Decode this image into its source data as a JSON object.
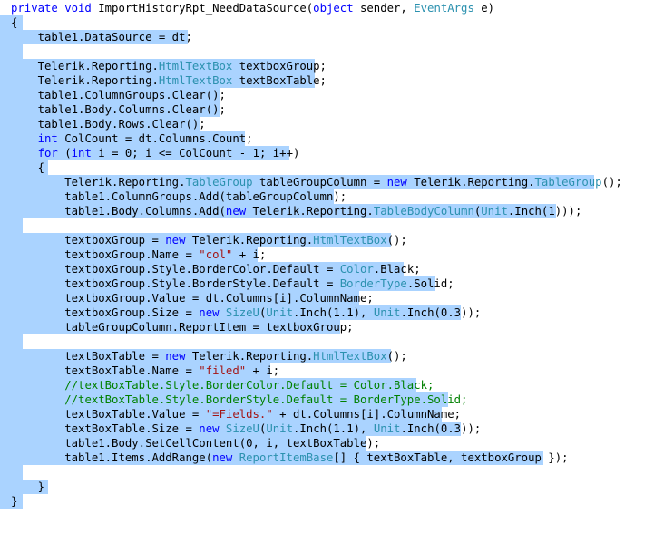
{
  "editor": {
    "colors": {
      "keyword": "#0000ff",
      "type": "#2b91af",
      "string": "#a31515",
      "comment": "#008000",
      "selection": "#aad3ff",
      "text": "#000000"
    },
    "lines": [
      {
        "sel": false,
        "t": [
          [
            "kw",
            "private void "
          ],
          [
            "",
            "ImportHistoryRpt_NeedDataSource("
          ],
          [
            "kw",
            "object"
          ],
          [
            "",
            " sender, "
          ],
          [
            "typ",
            "EventArgs"
          ],
          [
            "",
            " e)"
          ]
        ]
      },
      {
        "sel": true,
        "t": [
          [
            "",
            "{"
          ]
        ]
      },
      {
        "sel": true,
        "t": [
          [
            "",
            "    table1.DataSource = dt;"
          ]
        ]
      },
      {
        "sel": true,
        "t": [
          [
            "",
            ""
          ]
        ]
      },
      {
        "sel": true,
        "t": [
          [
            "",
            "    Telerik.Reporting."
          ],
          [
            "typ",
            "HtmlTextBox"
          ],
          [
            "",
            " textboxGroup;"
          ]
        ]
      },
      {
        "sel": true,
        "t": [
          [
            "",
            "    Telerik.Reporting."
          ],
          [
            "typ",
            "HtmlTextBox"
          ],
          [
            "",
            " textBoxTable;"
          ]
        ]
      },
      {
        "sel": true,
        "t": [
          [
            "",
            "    table1.ColumnGroups.Clear();"
          ]
        ]
      },
      {
        "sel": true,
        "t": [
          [
            "",
            "    table1.Body.Columns.Clear();"
          ]
        ]
      },
      {
        "sel": true,
        "t": [
          [
            "",
            "    table1.Body.Rows.Clear();"
          ]
        ]
      },
      {
        "sel": true,
        "t": [
          [
            "",
            "    "
          ],
          [
            "kw",
            "int"
          ],
          [
            "",
            " ColCount = dt.Columns.Count;"
          ]
        ]
      },
      {
        "sel": true,
        "t": [
          [
            "",
            "    "
          ],
          [
            "kw",
            "for"
          ],
          [
            "",
            " ("
          ],
          [
            "kw",
            "int"
          ],
          [
            "",
            " i = 0; i <= ColCount - 1; i++)"
          ]
        ]
      },
      {
        "sel": true,
        "t": [
          [
            "",
            "    {"
          ]
        ]
      },
      {
        "sel": true,
        "t": [
          [
            "",
            "        Telerik.Reporting."
          ],
          [
            "typ",
            "TableGroup"
          ],
          [
            "",
            " tableGroupColumn = "
          ],
          [
            "kw",
            "new"
          ],
          [
            "",
            " Telerik.Reporting."
          ],
          [
            "typ",
            "TableGroup"
          ],
          [
            "",
            "();"
          ]
        ]
      },
      {
        "sel": true,
        "t": [
          [
            "",
            "        table1.ColumnGroups.Add(tableGroupColumn);"
          ]
        ]
      },
      {
        "sel": true,
        "t": [
          [
            "",
            "        table1.Body.Columns.Add("
          ],
          [
            "kw",
            "new"
          ],
          [
            "",
            " Telerik.Reporting."
          ],
          [
            "typ",
            "TableBodyColumn"
          ],
          [
            "",
            "("
          ],
          [
            "typ",
            "Unit"
          ],
          [
            "",
            ".Inch(1)));"
          ]
        ]
      },
      {
        "sel": true,
        "t": [
          [
            "",
            ""
          ]
        ]
      },
      {
        "sel": true,
        "t": [
          [
            "",
            "        textboxGroup = "
          ],
          [
            "kw",
            "new"
          ],
          [
            "",
            " Telerik.Reporting."
          ],
          [
            "typ",
            "HtmlTextBox"
          ],
          [
            "",
            "();"
          ]
        ]
      },
      {
        "sel": true,
        "t": [
          [
            "",
            "        textboxGroup.Name = "
          ],
          [
            "str",
            "\"col\""
          ],
          [
            "",
            " + i;"
          ]
        ]
      },
      {
        "sel": true,
        "t": [
          [
            "",
            "        textboxGroup.Style.BorderColor.Default = "
          ],
          [
            "typ",
            "Color"
          ],
          [
            "",
            ".Black;"
          ]
        ]
      },
      {
        "sel": true,
        "t": [
          [
            "",
            "        textboxGroup.Style.BorderStyle.Default = "
          ],
          [
            "typ",
            "BorderType"
          ],
          [
            "",
            ".Solid;"
          ]
        ]
      },
      {
        "sel": true,
        "t": [
          [
            "",
            "        textboxGroup.Value = dt.Columns[i].ColumnName;"
          ]
        ]
      },
      {
        "sel": true,
        "t": [
          [
            "",
            "        textboxGroup.Size = "
          ],
          [
            "kw",
            "new"
          ],
          [
            "",
            " "
          ],
          [
            "typ",
            "SizeU"
          ],
          [
            "",
            "("
          ],
          [
            "typ",
            "Unit"
          ],
          [
            "",
            ".Inch(1.1), "
          ],
          [
            "typ",
            "Unit"
          ],
          [
            "",
            ".Inch(0.3));"
          ]
        ]
      },
      {
        "sel": true,
        "t": [
          [
            "",
            "        tableGroupColumn.ReportItem = textboxGroup;"
          ]
        ]
      },
      {
        "sel": true,
        "t": [
          [
            "",
            ""
          ]
        ]
      },
      {
        "sel": true,
        "t": [
          [
            "",
            "        textBoxTable = "
          ],
          [
            "kw",
            "new"
          ],
          [
            "",
            " Telerik.Reporting."
          ],
          [
            "typ",
            "HtmlTextBox"
          ],
          [
            "",
            "();"
          ]
        ]
      },
      {
        "sel": true,
        "t": [
          [
            "",
            "        textBoxTable.Name = "
          ],
          [
            "str",
            "\"filed\""
          ],
          [
            "",
            " + i;"
          ]
        ]
      },
      {
        "sel": true,
        "t": [
          [
            "",
            "        "
          ],
          [
            "cmt",
            "//textBoxTable.Style.BorderColor.Default = Color.Black;"
          ]
        ]
      },
      {
        "sel": true,
        "t": [
          [
            "",
            "        "
          ],
          [
            "cmt",
            "//textBoxTable.Style.BorderStyle.Default = BorderType.Solid;"
          ]
        ]
      },
      {
        "sel": true,
        "t": [
          [
            "",
            "        textBoxTable.Value = "
          ],
          [
            "str",
            "\"=Fields.\""
          ],
          [
            "",
            " + dt.Columns[i].ColumnName;"
          ]
        ]
      },
      {
        "sel": true,
        "t": [
          [
            "",
            "        textBoxTable.Size = "
          ],
          [
            "kw",
            "new"
          ],
          [
            "",
            " "
          ],
          [
            "typ",
            "SizeU"
          ],
          [
            "",
            "("
          ],
          [
            "typ",
            "Unit"
          ],
          [
            "",
            ".Inch(1.1), "
          ],
          [
            "typ",
            "Unit"
          ],
          [
            "",
            ".Inch(0.3));"
          ]
        ]
      },
      {
        "sel": true,
        "t": [
          [
            "",
            "        table1.Body.SetCellContent(0, i, textBoxTable);"
          ]
        ]
      },
      {
        "sel": true,
        "t": [
          [
            "",
            "        table1.Items.AddRange("
          ],
          [
            "kw",
            "new"
          ],
          [
            "",
            " "
          ],
          [
            "typ",
            "ReportItemBase"
          ],
          [
            "",
            "[] { textBoxTable, textboxGroup });"
          ]
        ]
      },
      {
        "sel": true,
        "t": [
          [
            "",
            ""
          ]
        ]
      },
      {
        "sel": true,
        "t": [
          [
            "",
            "    }"
          ]
        ]
      },
      {
        "sel": true,
        "t": [
          [
            "",
            "}"
          ]
        ]
      }
    ]
  }
}
